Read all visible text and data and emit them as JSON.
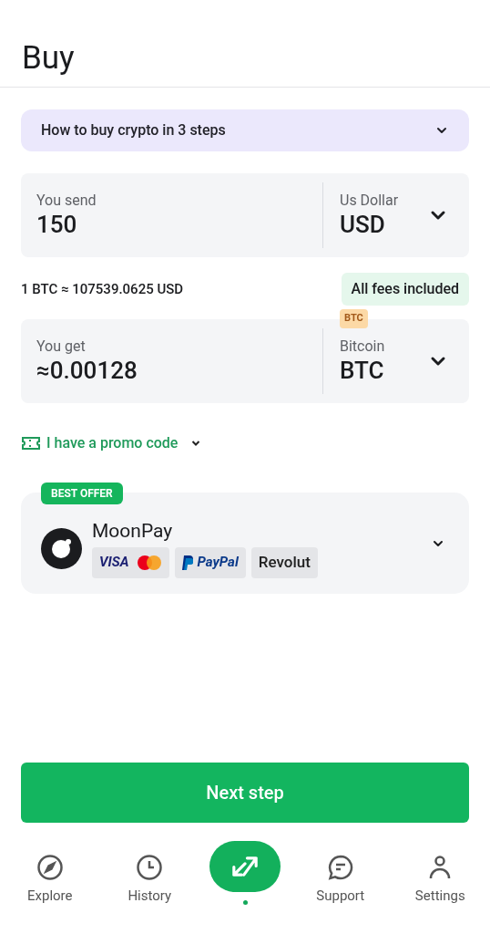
{
  "header": {
    "title": "Buy"
  },
  "guide": {
    "label": "How to buy crypto in 3 steps",
    "expanded": false
  },
  "send": {
    "label": "You send",
    "value": "150",
    "currency_name": "Us Dollar",
    "currency_code": "USD"
  },
  "rate": {
    "text": "1 BTC ≈ 107539.0625 USD",
    "fees_badge": "All fees included"
  },
  "get": {
    "label": "You get",
    "value": "≈0.00128",
    "currency_name": "Bitcoin",
    "currency_code": "BTC",
    "network_badge": "BTC"
  },
  "promo": {
    "label": "I have a promo code",
    "expanded": false
  },
  "provider": {
    "badge": "BEST OFFER",
    "name": "MoonPay",
    "methods": [
      {
        "kind": "visa_mastercard",
        "label": "VISA"
      },
      {
        "kind": "paypal",
        "label": "PayPal"
      },
      {
        "kind": "revolut",
        "label": "Revolut"
      }
    ]
  },
  "next_button": {
    "label": "Next step"
  },
  "nav": [
    {
      "kind": "explore",
      "label": "Explore",
      "selected": false
    },
    {
      "kind": "history",
      "label": "History",
      "selected": false
    },
    {
      "kind": "swap",
      "selected": true
    },
    {
      "kind": "support",
      "label": "Support",
      "selected": false
    },
    {
      "kind": "settings",
      "label": "Settings",
      "selected": false
    }
  ]
}
